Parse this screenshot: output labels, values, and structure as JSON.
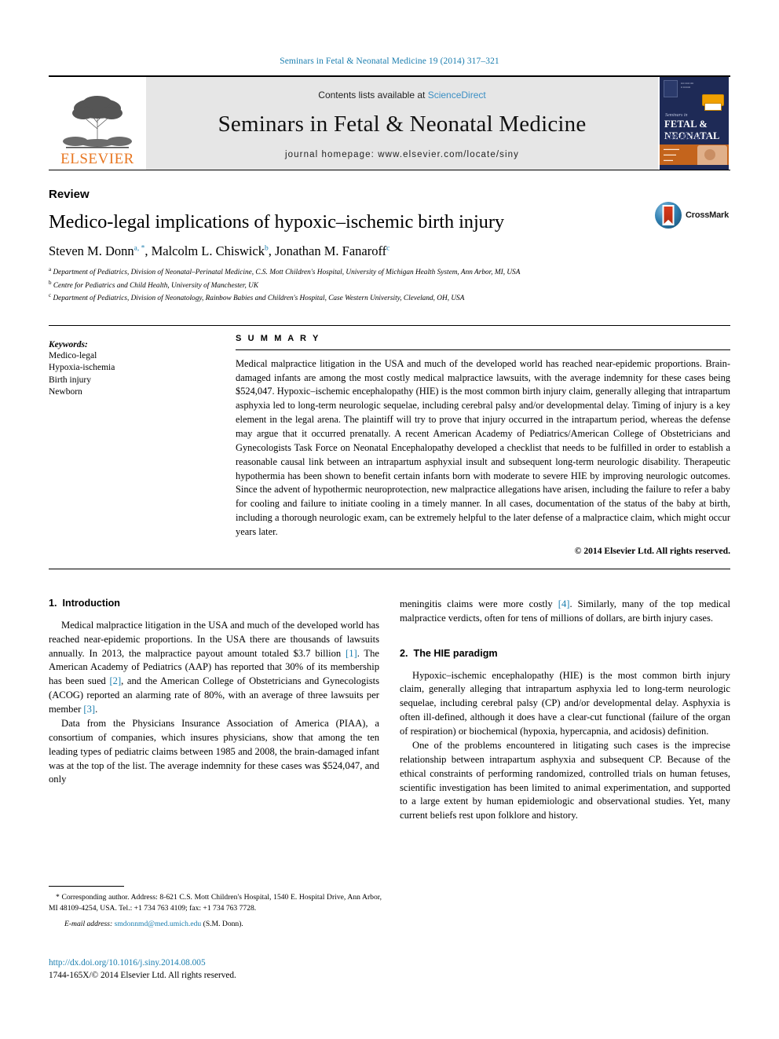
{
  "running_head": "Seminars in Fetal & Neonatal Medicine 19 (2014) 317–321",
  "masthead": {
    "publisher": "ELSEVIER",
    "contents_prefix": "Contents lists available at ",
    "contents_link": "ScienceDirect",
    "journal_title": "Seminars in Fetal & Neonatal Medicine",
    "homepage": "journal homepage: www.elsevier.com/locate/siny",
    "cover": {
      "series": "Seminars in",
      "main": "FETAL & NEONATAL",
      "sub": "medicine",
      "seal": "CONTINUING MEDICAL EDUCATION",
      "band_text": "THE NEWBORN WITH RESPIRATORY DISTRESS"
    }
  },
  "article": {
    "doctype": "Review",
    "title": "Medico-legal implications of hypoxic–ischemic birth injury",
    "authors": [
      {
        "name": "Steven M. Donn",
        "marks": "a, *"
      },
      {
        "name": "Malcolm L. Chiswick",
        "marks": "b"
      },
      {
        "name": "Jonathan M. Fanaroff",
        "marks": "c"
      }
    ],
    "affiliations": [
      {
        "mark": "a",
        "text": "Department of Pediatrics, Division of Neonatal–Perinatal Medicine, C.S. Mott Children's Hospital, University of Michigan Health System, Ann Arbor, MI, USA"
      },
      {
        "mark": "b",
        "text": "Centre for Pediatrics and Child Health, University of Manchester, UK"
      },
      {
        "mark": "c",
        "text": "Department of Pediatrics, Division of Neonatology, Rainbow Babies and Children's Hospital, Case Western University, Cleveland, OH, USA"
      }
    ],
    "crossmark_label": "CrossMark"
  },
  "keywords": {
    "label": "Keywords:",
    "items": [
      "Medico-legal",
      "Hypoxia-ischemia",
      "Birth injury",
      "Newborn"
    ]
  },
  "summary": {
    "label": "S U M M A R Y",
    "text": "Medical malpractice litigation in the USA and much of the developed world has reached near-epidemic proportions. Brain-damaged infants are among the most costly medical malpractice lawsuits, with the average indemnity for these cases being $524,047. Hypoxic–ischemic encephalopathy (HIE) is the most common birth injury claim, generally alleging that intrapartum asphyxia led to long-term neurologic sequelae, including cerebral palsy and/or developmental delay. Timing of injury is a key element in the legal arena. The plaintiff will try to prove that injury occurred in the intrapartum period, whereas the defense may argue that it occurred prenatally. A recent American Academy of Pediatrics/American College of Obstetricians and Gynecologists Task Force on Neonatal Encephalopathy developed a checklist that needs to be fulfilled in order to establish a reasonable causal link between an intrapartum asphyxial insult and subsequent long-term neurologic disability. Therapeutic hypothermia has been shown to benefit certain infants born with moderate to severe HIE by improving neurologic outcomes. Since the advent of hypothermic neuroprotection, new malpractice allegations have arisen, including the failure to refer a baby for cooling and failure to initiate cooling in a timely manner. In all cases, documentation of the status of the baby at birth, including a thorough neurologic exam, can be extremely helpful to the later defense of a malpractice claim, which might occur years later.",
    "copyright": "© 2014 Elsevier Ltd. All rights reserved."
  },
  "sections": {
    "intro": {
      "number": "1.",
      "heading": "Introduction",
      "p1_a": "Medical malpractice litigation in the USA and much of the developed world has reached near-epidemic proportions. In the USA there are thousands of lawsuits annually. In 2013, the malpractice payout amount totaled $3.7 billion ",
      "p1_ref1": "[1]",
      "p1_b": ". The American Academy of Pediatrics (AAP) has reported that 30% of its membership has been sued ",
      "p1_ref2": "[2]",
      "p1_c": ", and the American College of Obstetricians and Gynecologists (ACOG) reported an alarming rate of 80%, with an average of three lawsuits per member ",
      "p1_ref3": "[3]",
      "p1_d": ".",
      "p2_a": "Data from the Physicians Insurance Association of America (PIAA), a consortium of companies, which insures physicians, show that among the ten leading types of pediatric claims between 1985 and 2008, the brain-damaged infant was at the top of the list. The average indemnity for these cases was $524,047, and only",
      "p2_cont_a": "meningitis claims were more costly ",
      "p2_cont_ref": "[4]",
      "p2_cont_b": ". Similarly, many of the top medical malpractice verdicts, often for tens of millions of dollars, are birth injury cases."
    },
    "hie": {
      "number": "2.",
      "heading": "The HIE paradigm",
      "p1": "Hypoxic–ischemic encephalopathy (HIE) is the most common birth injury claim, generally alleging that intrapartum asphyxia led to long-term neurologic sequelae, including cerebral palsy (CP) and/or developmental delay. Asphyxia is often ill-defined, although it does have a clear-cut functional (failure of the organ of respiration) or biochemical (hypoxia, hypercapnia, and acidosis) definition.",
      "p2": "One of the problems encountered in litigating such cases is the imprecise relationship between intrapartum asphyxia and subsequent CP. Because of the ethical constraints of performing randomized, controlled trials on human fetuses, scientific investigation has been limited to animal experimentation, and supported to a large extent by human epidemiologic and observational studies. Yet, many current beliefs rest upon folklore and history."
    }
  },
  "footnote": {
    "corresponding": "* Corresponding author. Address: 8-621 C.S. Mott Children's Hospital, 1540 E. Hospital Drive, Ann Arbor, MI 48109-4254, USA. Tel.: +1 734 763 4109; fax: +1 734 763 7728.",
    "email_label": "E-mail address:",
    "email": "smdonnmd@med.umich.edu",
    "email_suffix": " (S.M. Donn)."
  },
  "doi": {
    "url": "http://dx.doi.org/10.1016/j.siny.2014.08.005",
    "issn_line": "1744-165X/© 2014 Elsevier Ltd. All rights reserved."
  },
  "colors": {
    "link_blue": "#1b7eaf",
    "elsevier_orange": "#e87722",
    "band_gray": "#e6e6e6",
    "cover_navy": "#1e2a56"
  }
}
